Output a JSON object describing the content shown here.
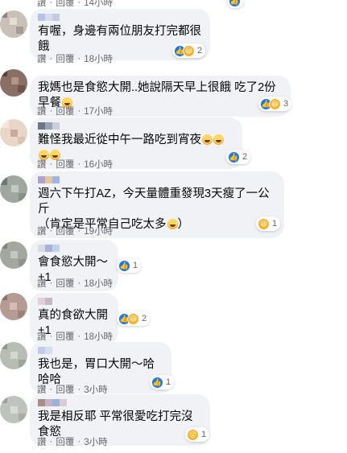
{
  "comments": [
    {
      "text": "有喔，身邊有兩位朋友打完都很餓",
      "emojis": 0,
      "reactions": [
        "like",
        "haha"
      ],
      "count": "2",
      "meta": {
        "like": "讚",
        "reply": "回覆",
        "time": "18小時"
      }
    },
    {
      "text": "我媽也是食慾大開..她說隔天早上很餓 吃了2份早餐",
      "emojis": 1,
      "reactions": [
        "like",
        "haha"
      ],
      "count": "3",
      "meta": {
        "like": "讚",
        "reply": "回覆",
        "time": "17小時"
      }
    },
    {
      "text": "難怪我最近從中午一路吃到宵夜",
      "emojis": 4,
      "reactions": [
        "like"
      ],
      "count": "2",
      "meta": {
        "like": "讚",
        "reply": "回覆",
        "time": "16小時"
      }
    },
    {
      "text": "週六下午打AZ，今天量體重發現3天瘦了一公斤\n（肯定是平常自己吃太多",
      "emojis": 1,
      "emojis2": 1,
      "tail": "）",
      "reactions": [
        "haha"
      ],
      "count": "1",
      "meta": {
        "like": "讚",
        "reply": "回覆",
        "time": "19小時"
      }
    },
    {
      "text": "會食慾大開～+1",
      "emojis": 0,
      "reactions": [
        "like"
      ],
      "count": "1",
      "meta": {
        "like": "讚",
        "reply": "回覆",
        "time": "18小時"
      }
    },
    {
      "text": "真的食欲大開+1",
      "emojis": 0,
      "reactions": [
        "like",
        "haha"
      ],
      "count": "2",
      "meta": {
        "like": "讚",
        "reply": "回覆",
        "time": "18小時"
      }
    },
    {
      "text": "我也是，胃口大開～哈哈哈",
      "emojis": 0,
      "reactions": [
        "like"
      ],
      "count": "1",
      "meta": {
        "like": "讚",
        "reply": "回覆",
        "time": "3小時"
      }
    },
    {
      "text": "我是相反耶 平常很愛吃打完沒食慾",
      "emojis": 0,
      "reactions": [
        "wow"
      ],
      "count": "1",
      "meta": {
        "like": "讚",
        "reply": "回覆",
        "time": "3小時"
      }
    }
  ],
  "top_meta": {
    "like": "讚",
    "reply": "回覆",
    "time": "14小時"
  },
  "colors": {
    "bubble": "#f0f2f5",
    "meta": "#65676b",
    "like": "#1877f2",
    "haha": "#f7b125"
  }
}
